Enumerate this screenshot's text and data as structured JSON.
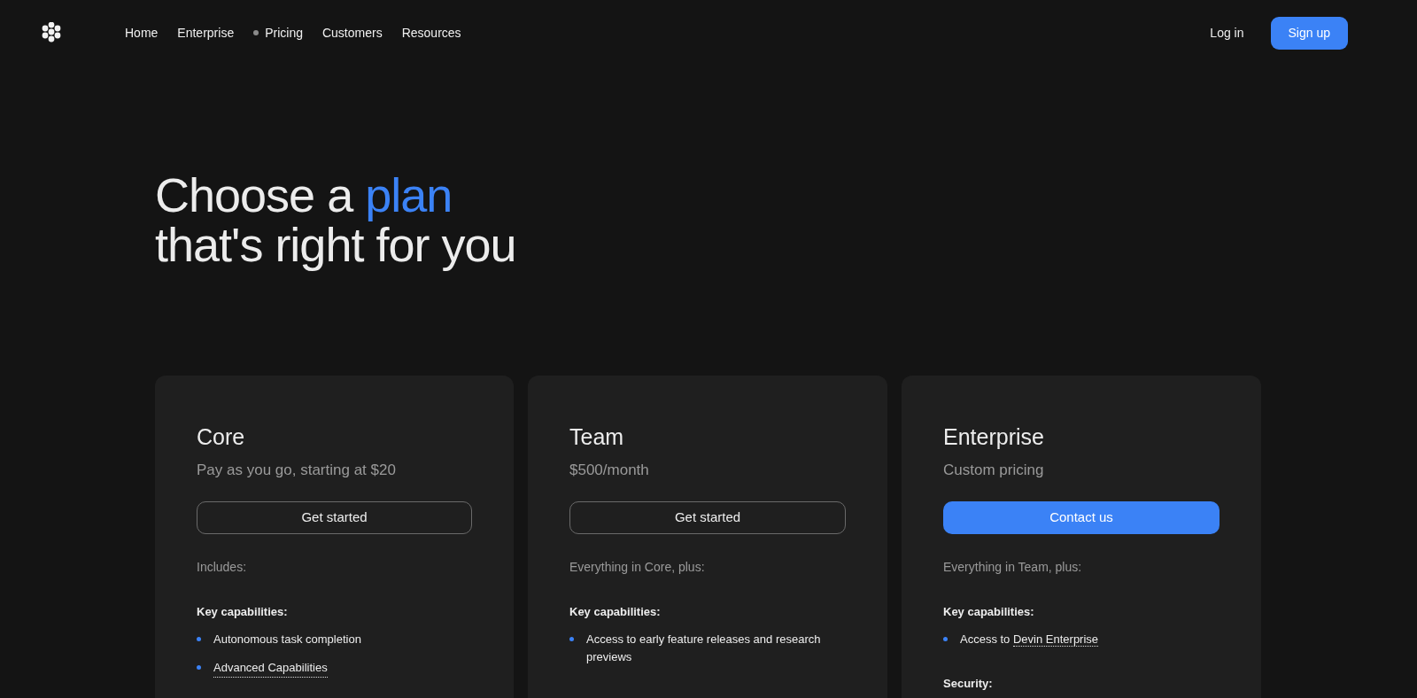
{
  "nav": {
    "links": [
      {
        "label": "Home",
        "selected": false
      },
      {
        "label": "Enterprise",
        "selected": false
      },
      {
        "label": "Pricing",
        "selected": true
      },
      {
        "label": "Customers",
        "selected": false
      },
      {
        "label": "Resources",
        "selected": false
      }
    ],
    "login": "Log in",
    "signup": "Sign up"
  },
  "hero": {
    "title_start": "Choose a ",
    "title_accent": "plan",
    "title_end": "that's right for you"
  },
  "plans": [
    {
      "name": "Core",
      "price": "Pay as you go, starting at $20",
      "button": {
        "label": "Get started",
        "primary": false
      },
      "includes": "Includes:",
      "sections": [
        {
          "heading": "Key capabilities:",
          "items": [
            {
              "text": "Autonomous task completion"
            },
            {
              "link": "Advanced Capabilities"
            }
          ]
        }
      ]
    },
    {
      "name": "Team",
      "price": "$500/month",
      "button": {
        "label": "Get started",
        "primary": false
      },
      "includes": "Everything in Core, plus:",
      "sections": [
        {
          "heading": "Key capabilities:",
          "items": [
            {
              "text": "Access to early feature releases and research previews"
            }
          ]
        }
      ]
    },
    {
      "name": "Enterprise",
      "price": "Custom pricing",
      "button": {
        "label": "Contact us",
        "primary": true
      },
      "includes": "Everything in Team, plus:",
      "sections": [
        {
          "heading": "Key capabilities:",
          "items": [
            {
              "text": "Access to ",
              "link": "Devin Enterprise"
            }
          ]
        },
        {
          "heading": "Security:"
        }
      ]
    }
  ]
}
